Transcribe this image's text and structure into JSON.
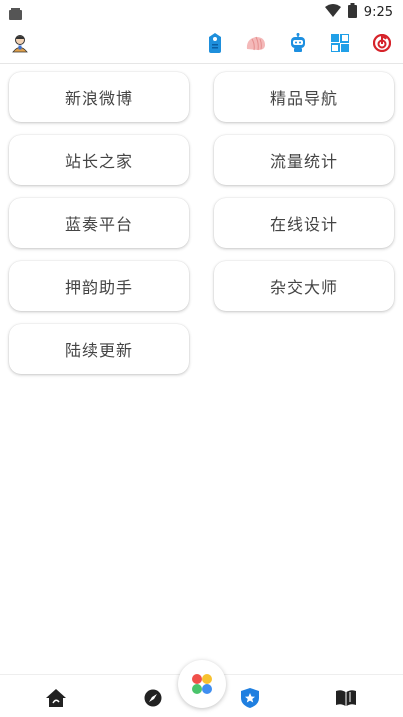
{
  "status_bar": {
    "time": "9:25",
    "icons": [
      "notification-square-icon",
      "wifi-icon",
      "battery-icon"
    ]
  },
  "toolbar": {
    "left_icon": "user-avatar-icon",
    "right_icons": [
      "tag-icon",
      "shell-icon",
      "robot-icon",
      "grid-app-icon",
      "music-disc-icon"
    ]
  },
  "grid": {
    "items": [
      {
        "label": "新浪微博"
      },
      {
        "label": "精品导航"
      },
      {
        "label": "站长之家"
      },
      {
        "label": "流量统计"
      },
      {
        "label": "蓝奏平台"
      },
      {
        "label": "在线设计"
      },
      {
        "label": "押韵助手"
      },
      {
        "label": "杂交大师"
      },
      {
        "label": "陆续更新"
      }
    ]
  },
  "bottom_nav": {
    "items": [
      "home-icon",
      "compass-icon",
      "apps-icon",
      "shield-star-icon",
      "book-icon"
    ]
  },
  "colors": {
    "accent_blue": "#2a86e8",
    "fab_red": "#f0504a",
    "fab_yellow": "#f7c12f",
    "fab_green": "#4ac46b",
    "fab_blue": "#3f8ef0",
    "icon_red": "#d6232a",
    "icon_pink": "#f2b8b8"
  }
}
